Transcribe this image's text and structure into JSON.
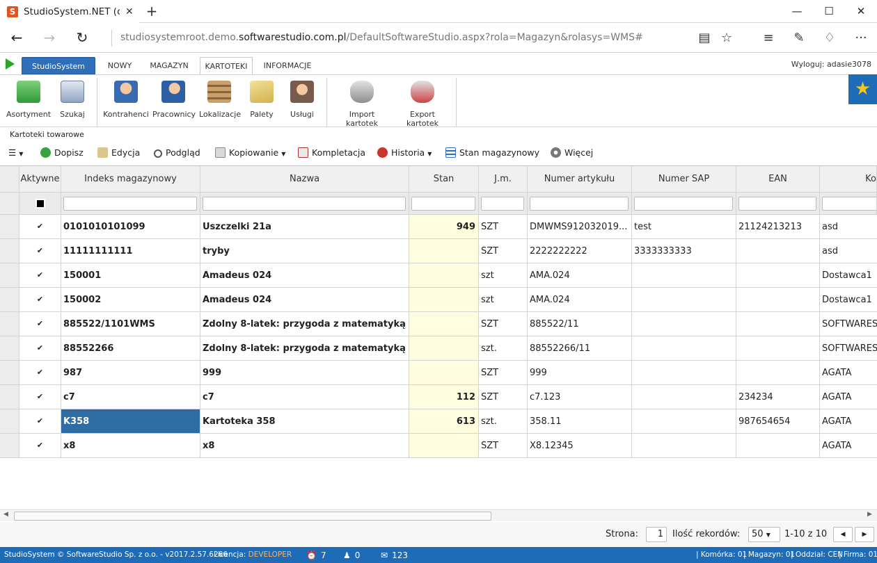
{
  "browser": {
    "tab_title": "StudioSystem.NET (c) Sc",
    "tab_close": "✕",
    "new_tab": "+",
    "url_prefix": "studiosystemroot.demo.",
    "url_domain": "softwarestudio.com.pl",
    "url_path": "/DefaultSoftwareStudio.aspx?rola=Magazyn&rolasys=WMS#"
  },
  "menu": {
    "brand": "StudioSystem",
    "tabs": [
      "NOWY",
      "MAGAZYN",
      "KARTOTEKI",
      "INFORMACJE"
    ],
    "active_tab": "KARTOTEKI",
    "logout": "Wyloguj: adasie3078"
  },
  "ribbon": {
    "items": [
      "Asortyment",
      "Szukaj",
      "Kontrahenci",
      "Pracownicy",
      "Lokalizacje",
      "Palety",
      "Usługi",
      "Import kartotek",
      "Export kartotek"
    ]
  },
  "section_title": "Kartoteki towarowe",
  "toolbar": {
    "add": "Dopisz",
    "edit": "Edycja",
    "preview": "Podgląd",
    "copy": "Kopiowanie",
    "complete": "Kompletacja",
    "history": "Historia",
    "stock": "Stan magazynowy",
    "more": "Więcej"
  },
  "grid": {
    "columns": [
      "Aktywne",
      "Indeks magazynowy",
      "Nazwa",
      "Stan",
      "J.m.",
      "Numer artykułu",
      "Numer SAP",
      "EAN",
      "Ko"
    ],
    "rows": [
      {
        "active": "✔",
        "index": "0101010101099",
        "name": "Uszczelki 21a",
        "stan": "949",
        "jm": "SZT",
        "art": "DMWMS912032019...",
        "sap": "test",
        "ean": "21124213213",
        "ko": "asd"
      },
      {
        "active": "✔",
        "index": "11111111111",
        "name": "tryby",
        "stan": "",
        "jm": "SZT",
        "art": "2222222222",
        "sap": "3333333333",
        "ean": "",
        "ko": "asd"
      },
      {
        "active": "✔",
        "index": "150001",
        "name": "Amadeus 024",
        "stan": "",
        "jm": "szt",
        "art": "AMA.024",
        "sap": "",
        "ean": "",
        "ko": "Dostawca1"
      },
      {
        "active": "✔",
        "index": "150002",
        "name": "Amadeus 024",
        "stan": "",
        "jm": "szt",
        "art": "AMA.024",
        "sap": "",
        "ean": "",
        "ko": "Dostawca1"
      },
      {
        "active": "✔",
        "index": "885522/1101WMS",
        "name": "Zdolny 8-latek: przygoda z matematyką",
        "stan": "",
        "jm": "SZT",
        "art": "885522/11",
        "sap": "",
        "ean": "",
        "ko": "SOFTWARES"
      },
      {
        "active": "✔",
        "index": "88552266",
        "name": "Zdolny 8-latek: przygoda z matematyką",
        "stan": "",
        "jm": "szt.",
        "art": "88552266/11",
        "sap": "",
        "ean": "",
        "ko": "SOFTWARES"
      },
      {
        "active": "✔",
        "index": "987",
        "name": "999",
        "stan": "",
        "jm": "SZT",
        "art": "999",
        "sap": "",
        "ean": "",
        "ko": "AGATA"
      },
      {
        "active": "✔",
        "index": "c7",
        "name": "c7",
        "stan": "112",
        "jm": "SZT",
        "art": "c7.123",
        "sap": "",
        "ean": "234234",
        "ko": "AGATA"
      },
      {
        "active": "✔",
        "index": "K358",
        "name": "Kartoteka 358",
        "stan": "613",
        "jm": "szt.",
        "art": "358.11",
        "sap": "",
        "ean": "987654654",
        "ko": "AGATA"
      },
      {
        "active": "✔",
        "index": "x8",
        "name": "x8",
        "stan": "",
        "jm": "SZT",
        "art": "X8.12345",
        "sap": "",
        "ean": "",
        "ko": "AGATA"
      }
    ]
  },
  "pager": {
    "page_label": "Strona:",
    "page_value": "1",
    "records_label": "Ilość rekordów:",
    "records_value": "50",
    "range": "1-10 z 10"
  },
  "status": {
    "copyright": "StudioSystem © SoftwareStudio Sp. z o.o. - v2017.2.57.6266",
    "license_label": "Licencja:",
    "license_value": "DEVELOPER",
    "count_alarm": "7",
    "count_users": "0",
    "count_mail": "123",
    "cell": "| Komórka: 01",
    "warehouse": "| Magazyn: 01",
    "dept": "| Oddział: CEN",
    "company": "| Firma: 01"
  },
  "colors": {
    "brand_blue": "#2f6fba",
    "status_blue": "#1e6bb8",
    "selected_cell": "#2e6da4",
    "stan_bg": "#fffde0",
    "license_orange": "#ffb25c"
  }
}
